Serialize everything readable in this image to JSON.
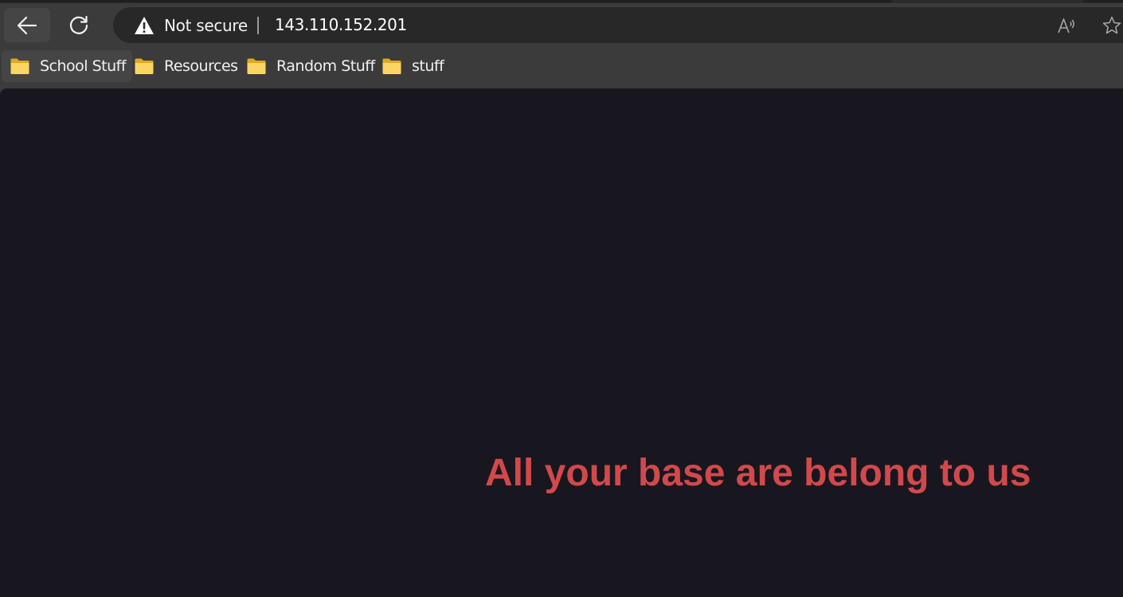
{
  "browser": {
    "security_label": "Not secure",
    "url": "143.110.152.201",
    "icons": {
      "back": "back-arrow-icon",
      "reload": "reload-icon",
      "security": "warning-icon",
      "read_aloud": "read-aloud-icon",
      "favorite": "star-icon"
    }
  },
  "bookmarks": [
    {
      "label": "School Stuff",
      "icon": "folder-icon"
    },
    {
      "label": "Resources",
      "icon": "folder-icon"
    },
    {
      "label": "Random Stuff",
      "icon": "folder-icon"
    },
    {
      "label": "stuff",
      "icon": "folder-icon"
    }
  ],
  "page": {
    "headline": "All your base are belong to us",
    "background_color": "#18171f",
    "headline_color": "#d2494b"
  }
}
